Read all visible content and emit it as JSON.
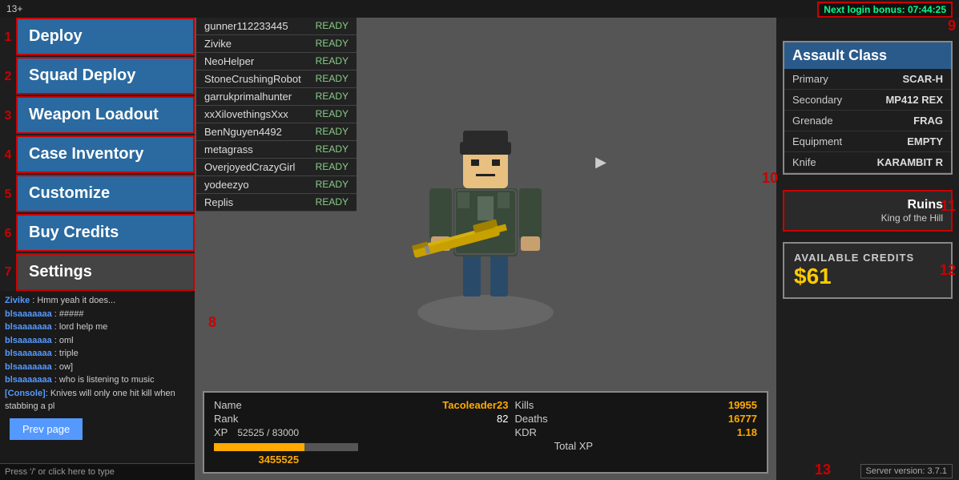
{
  "topbar": {
    "age_rating": "13+",
    "login_bonus_label": "Next login bonus: 07:44:25"
  },
  "sidebar": {
    "nav_items": [
      {
        "id": "deploy",
        "label": "Deploy",
        "marker": "1"
      },
      {
        "id": "squad-deploy",
        "label": "Squad Deploy",
        "marker": "2"
      },
      {
        "id": "weapon-loadout",
        "label": "Weapon Loadout",
        "marker": "3"
      },
      {
        "id": "case-inventory",
        "label": "Case Inventory",
        "marker": "4"
      },
      {
        "id": "customize",
        "label": "Customize",
        "marker": "5"
      },
      {
        "id": "buy-credits",
        "label": "Buy Credits",
        "marker": "6"
      },
      {
        "id": "settings",
        "label": "Settings",
        "marker": "7"
      }
    ],
    "prev_page_label": "Prev page"
  },
  "chat": {
    "lines": [
      {
        "name": "Zivike",
        "sep": " : ",
        "msg": " Hmm yeah it does..."
      },
      {
        "name": "blsaaaaaaa",
        "sep": " : ",
        "msg": " #####"
      },
      {
        "name": "blsaaaaaaa",
        "sep": " : ",
        "msg": " lord help me"
      },
      {
        "name": "blsaaaaaaa",
        "sep": " : ",
        "msg": " oml"
      },
      {
        "name": "blsaaaaaaa",
        "sep": " : ",
        "msg": " triple"
      },
      {
        "name": "blsaaaaaaa",
        "sep": " : ",
        "msg": " ow]"
      },
      {
        "name": "blsaaaaaaa",
        "sep": " : ",
        "msg": " who is listening to music"
      },
      {
        "name": "[Console]",
        "sep": ": ",
        "msg": "Knives will only one hit kill when stabbing a pl"
      }
    ],
    "input_hint": "Press '/' or click here to type"
  },
  "players": [
    {
      "name": "gunner112233445",
      "status": "READY"
    },
    {
      "name": "Zivike",
      "status": "READY"
    },
    {
      "name": "NeoHelper",
      "status": "READY"
    },
    {
      "name": "StoneCrushingRobot",
      "status": "READY"
    },
    {
      "name": "garrukprimalhunter",
      "status": "READY"
    },
    {
      "name": "xxXilovethingsXxx",
      "status": "READY"
    },
    {
      "name": "BenNguyen4492",
      "status": "READY"
    },
    {
      "name": "metagrass",
      "status": "READY"
    },
    {
      "name": "OverjoyedCrazyGirl",
      "status": "READY"
    },
    {
      "name": "yodeezyo",
      "status": "READY"
    },
    {
      "name": "Replis",
      "status": "READY"
    }
  ],
  "stats": {
    "name_label": "Name",
    "name_value": "Tacoleader23",
    "rank_label": "Rank",
    "rank_value": "82",
    "xp_label": "XP",
    "xp_value": "52525 / 83000",
    "xp_fill_pct": 63,
    "kills_label": "Kills",
    "kills_value": "19955",
    "deaths_label": "Deaths",
    "deaths_value": "16777",
    "kdr_label": "KDR",
    "kdr_value": "1.18",
    "total_xp_label": "Total XP",
    "total_xp_value": "3455525"
  },
  "class_panel": {
    "title": "Assault Class",
    "marker": "10",
    "rows": [
      {
        "label": "Primary",
        "value": "SCAR-H"
      },
      {
        "label": "Secondary",
        "value": "MP412 REX"
      },
      {
        "label": "Grenade",
        "value": "FRAG"
      },
      {
        "label": "Equipment",
        "value": "EMPTY"
      },
      {
        "label": "Knife",
        "value": "KARAMBIT R"
      }
    ]
  },
  "map": {
    "name": "Ruins",
    "mode": "King of the Hill",
    "marker": "11"
  },
  "credits": {
    "label": "AVAILABLE CREDITS",
    "amount": "$61",
    "marker": "12"
  },
  "server": {
    "version_label": "Server version: 3.7.1",
    "marker": "13"
  },
  "markers": {
    "8": "8",
    "9": "9"
  }
}
